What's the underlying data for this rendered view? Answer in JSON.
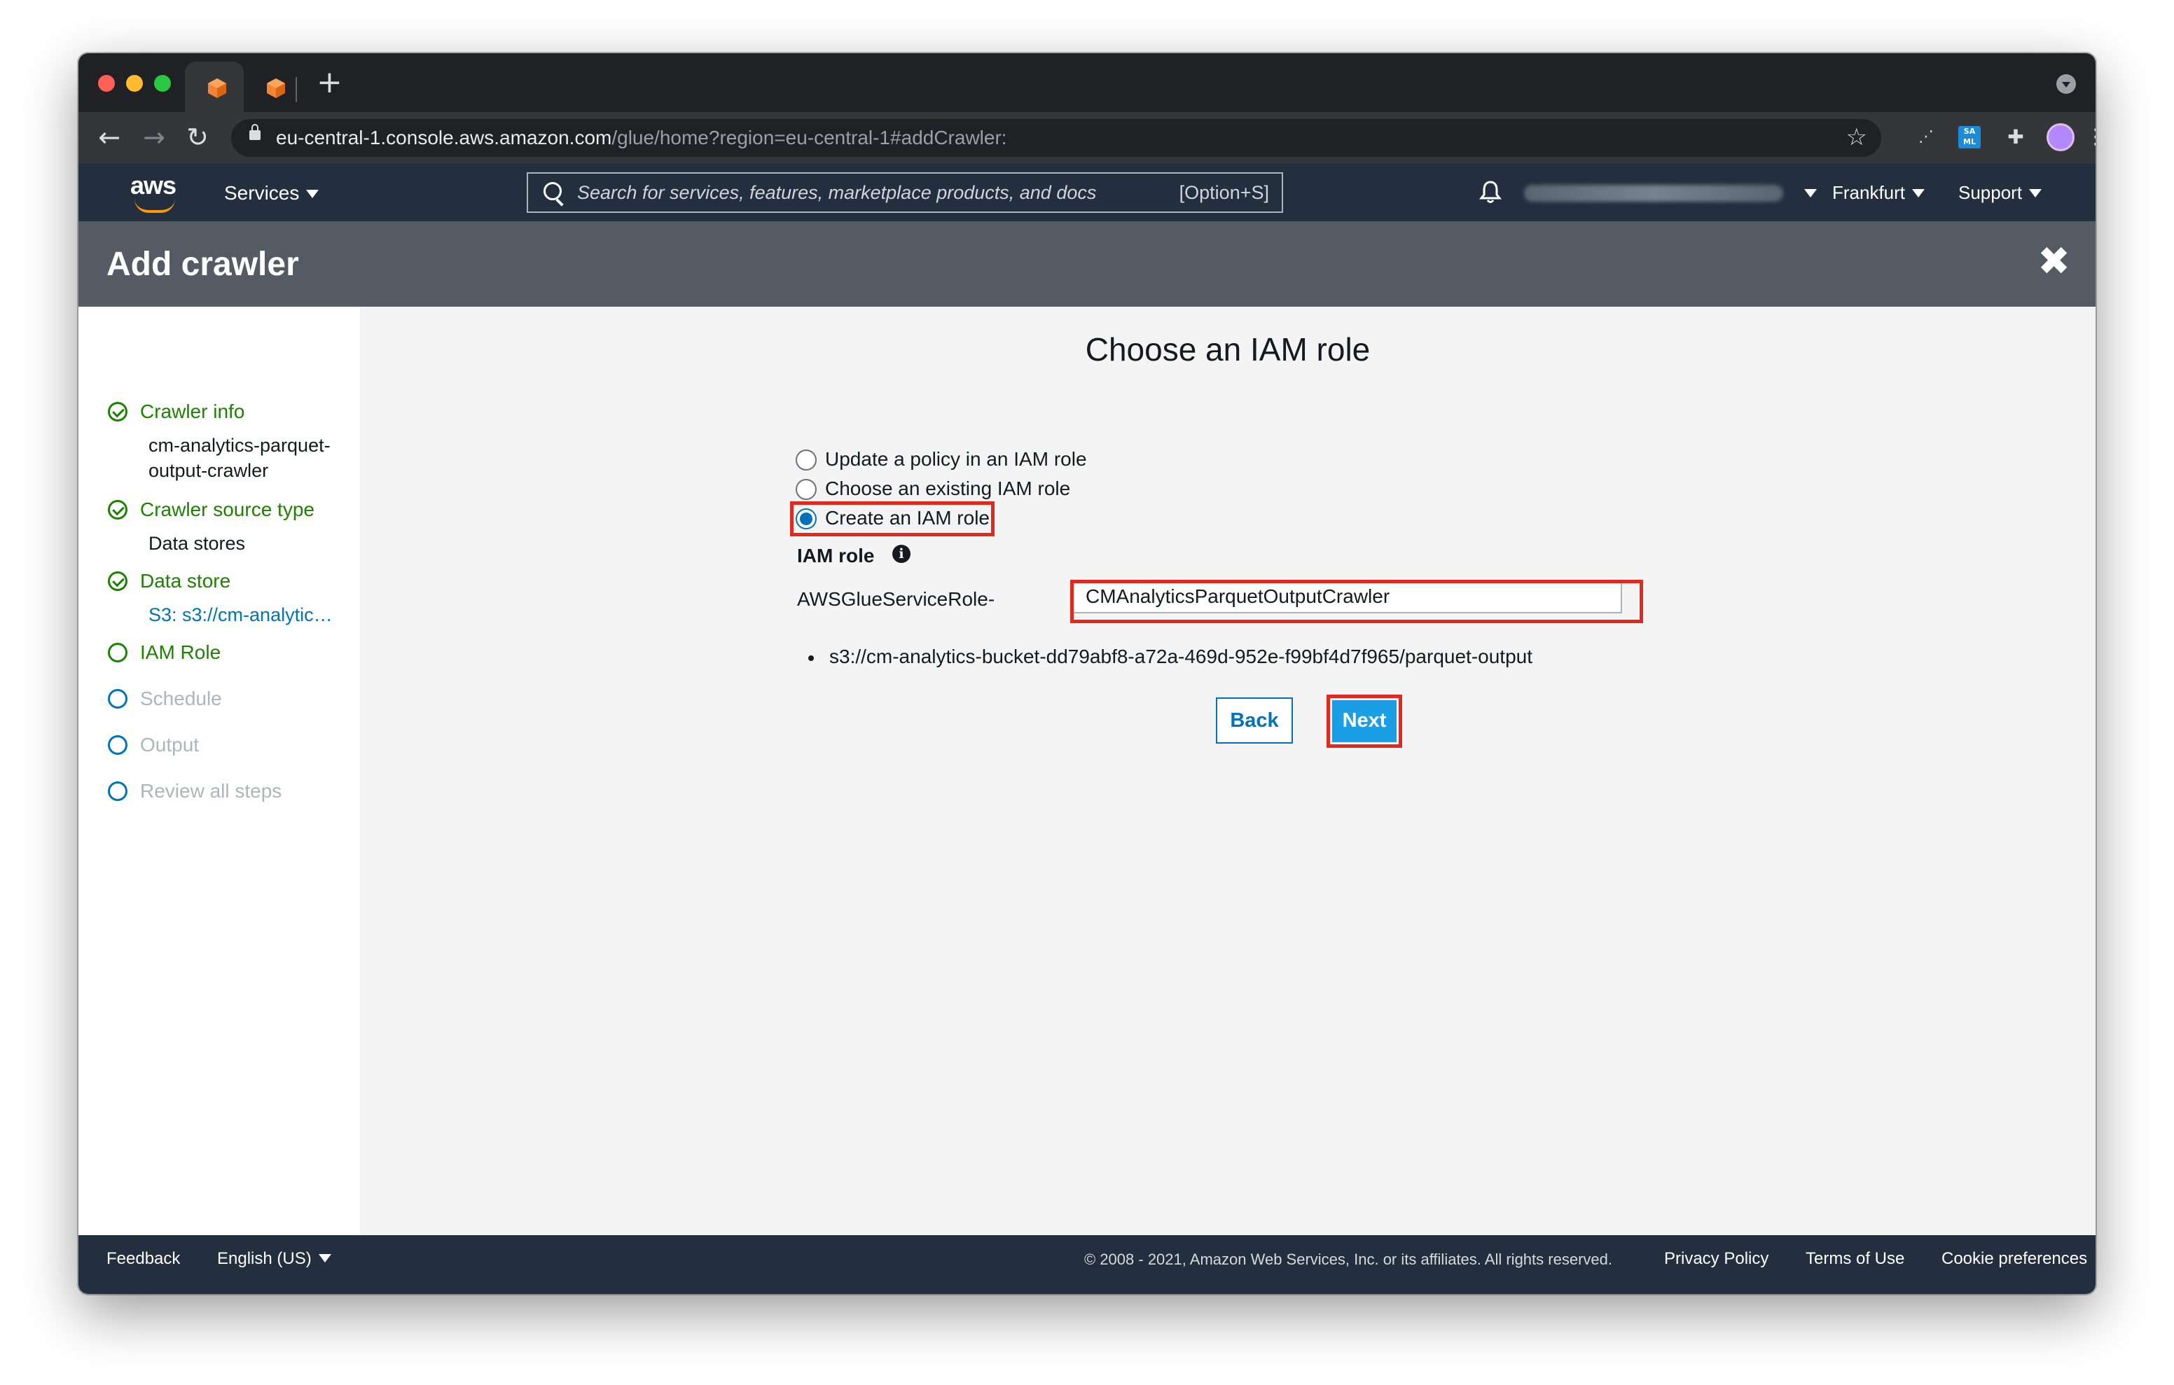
{
  "browser": {
    "url_host": "eu-central-1.console.aws.amazon.com",
    "url_path": "/glue/home?region=eu-central-1#addCrawler:",
    "new_tab_label": "+",
    "saml_label": "SA ML"
  },
  "aws_nav": {
    "logo_text": "aws",
    "services_label": "Services",
    "search_placeholder": "Search for services, features, marketplace products, and docs",
    "search_shortcut": "[Option+S]",
    "region_label": "Frankfurt",
    "support_label": "Support"
  },
  "page_header": {
    "title": "Add crawler",
    "close_icon": "close-icon"
  },
  "sidebar": {
    "steps": [
      {
        "label": "Crawler info",
        "status": "complete",
        "detail": "cm-analytics-parquet-output-crawler"
      },
      {
        "label": "Crawler source type",
        "status": "complete",
        "detail": "Data stores"
      },
      {
        "label": "Data store",
        "status": "complete",
        "detail": "S3: s3://cm-analytic…"
      },
      {
        "label": "IAM Role",
        "status": "current"
      },
      {
        "label": "Schedule",
        "status": "upcoming"
      },
      {
        "label": "Output",
        "status": "upcoming"
      },
      {
        "label": "Review all steps",
        "status": "upcoming"
      }
    ],
    "detail_line1": "cm-analytics-parquet-",
    "detail_line2": "output-crawler"
  },
  "main": {
    "heading": "Choose an IAM role",
    "options": [
      {
        "label": "Update a policy in an IAM role",
        "selected": false
      },
      {
        "label": "Choose an existing IAM role",
        "selected": false
      },
      {
        "label": "Create an IAM role",
        "selected": true
      }
    ],
    "iam_role_label": "IAM role",
    "info_icon": "i",
    "role_prefix": "AWSGlueServiceRole-",
    "role_name_value": "CMAnalyticsParquetOutputCrawler",
    "s3_path": "s3://cm-analytics-bucket-dd79abf8-a72a-469d-952e-f99bf4d7f965/parquet-output",
    "back_label": "Back",
    "next_label": "Next"
  },
  "footer": {
    "feedback": "Feedback",
    "language": "English (US)",
    "copyright": "© 2008 - 2021, Amazon Web Services, Inc. or its affiliates. All rights reserved.",
    "privacy": "Privacy Policy",
    "terms": "Terms of Use",
    "cookies": "Cookie preferences"
  },
  "colors": {
    "aws_nav_bg": "#232f3e",
    "header_bg": "#545b64",
    "complete_green": "#1d8102",
    "link_blue": "#0073bb",
    "primary_button": "#1a9fe6",
    "annotation_red": "#e0291f",
    "aws_orange": "#ff9900"
  }
}
